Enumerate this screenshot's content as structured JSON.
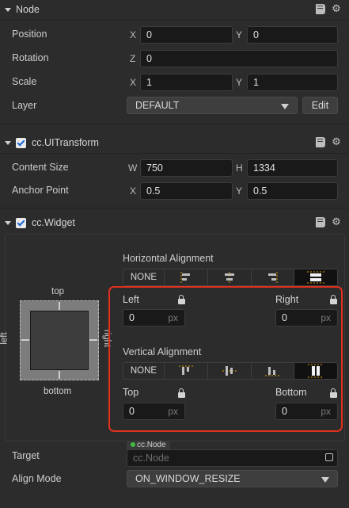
{
  "node": {
    "title": "Node",
    "position": {
      "label": "Position",
      "x_axis": "X",
      "x": "0",
      "y_axis": "Y",
      "y": "0"
    },
    "rotation": {
      "label": "Rotation",
      "z_axis": "Z",
      "z": "0"
    },
    "scale": {
      "label": "Scale",
      "x_axis": "X",
      "x": "1",
      "y_axis": "Y",
      "y": "1"
    },
    "layer": {
      "label": "Layer",
      "value": "DEFAULT",
      "edit": "Edit"
    }
  },
  "transform": {
    "title": "cc.UITransform",
    "content_size": {
      "label": "Content Size",
      "w_axis": "W",
      "w": "750",
      "h_axis": "H",
      "h": "1334"
    },
    "anchor": {
      "label": "Anchor Point",
      "x_axis": "X",
      "x": "0.5",
      "y_axis": "Y",
      "y": "0.5"
    }
  },
  "widget": {
    "title": "cc.Widget",
    "preview": {
      "top": "top",
      "bottom": "bottom",
      "left": "left",
      "right": "right"
    },
    "horizontal": {
      "title": "Horizontal Alignment",
      "none": "NONE",
      "left_label": "Left",
      "left_value": "0",
      "right_label": "Right",
      "right_value": "0"
    },
    "vertical": {
      "title": "Vertical Alignment",
      "none": "NONE",
      "top_label": "Top",
      "top_value": "0",
      "bottom_label": "Bottom",
      "bottom_value": "0"
    },
    "unit": "px",
    "target": {
      "label": "Target",
      "tag": "cc.Node",
      "placeholder": "cc.Node"
    },
    "align_mode": {
      "label": "Align Mode",
      "value": "ON_WINDOW_RESIZE"
    }
  },
  "icons": [
    "collapse-arrow-icon",
    "book-icon",
    "gear-icon",
    "lock-icon",
    "checkbox-icon",
    "target-picker-icon"
  ]
}
